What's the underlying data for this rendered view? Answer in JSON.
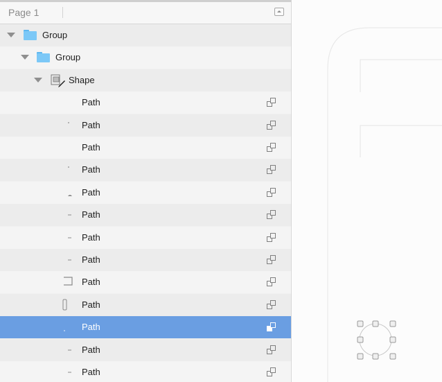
{
  "layers_panel": {
    "page_name": "Page 1",
    "collapse_icon": "collapse-panel-icon",
    "layers": [
      {
        "label": "Group",
        "kind": "group",
        "depth": 0,
        "expanded": true,
        "selected": false
      },
      {
        "label": "Group",
        "kind": "group",
        "depth": 1,
        "expanded": true,
        "selected": false
      },
      {
        "label": "Shape",
        "kind": "shape",
        "depth": 2,
        "expanded": true,
        "selected": false
      },
      {
        "label": "Path",
        "kind": "path",
        "thumb": "blank",
        "selected": false
      },
      {
        "label": "Path",
        "kind": "path",
        "thumb": "dot",
        "selected": false
      },
      {
        "label": "Path",
        "kind": "path",
        "thumb": "blank",
        "selected": false
      },
      {
        "label": "Path",
        "kind": "path",
        "thumb": "dot",
        "selected": false
      },
      {
        "label": "Path",
        "kind": "path",
        "thumb": "arc",
        "selected": false
      },
      {
        "label": "Path",
        "kind": "path",
        "thumb": "dash",
        "selected": false
      },
      {
        "label": "Path",
        "kind": "path",
        "thumb": "dash",
        "selected": false
      },
      {
        "label": "Path",
        "kind": "path",
        "thumb": "dash",
        "selected": false
      },
      {
        "label": "Path",
        "kind": "path",
        "thumb": "corner",
        "selected": false
      },
      {
        "label": "Path",
        "kind": "path",
        "thumb": "rounded-rect",
        "selected": false
      },
      {
        "label": "Path",
        "kind": "path",
        "thumb": "dot",
        "selected": true
      },
      {
        "label": "Path",
        "kind": "path",
        "thumb": "dash",
        "selected": false
      },
      {
        "label": "Path",
        "kind": "path",
        "thumb": "dash",
        "selected": false
      }
    ]
  },
  "colors": {
    "selection": "#6a9ee2",
    "folder": "#7cc8f7",
    "canvas": "#fcfcfc"
  }
}
